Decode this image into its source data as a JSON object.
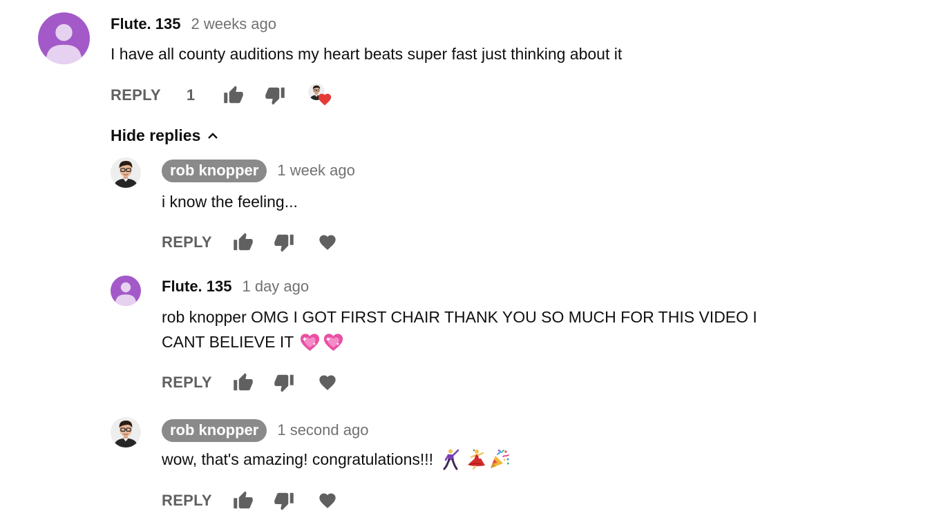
{
  "top_comment": {
    "author": "Flute. 135",
    "time": "2 weeks ago",
    "text": "I have all county auditions my heart beats super fast just thinking about it",
    "reply_label": "REPLY",
    "like_count": "1",
    "avatar_color": "#a35ac8",
    "hearted_by_creator": true
  },
  "replies_toggle": {
    "label": "Hide replies",
    "icon": "chevron-up-icon"
  },
  "replies": [
    {
      "author": "rob knopper",
      "is_creator": true,
      "time": "1 week ago",
      "text": "i know the feeling...",
      "reply_label": "REPLY"
    },
    {
      "author": "Flute. 135",
      "is_creator": false,
      "time": "1 day ago",
      "text_line1": "rob knopper OMG I GOT FIRST CHAIR THANK YOU SO MUCH FOR THIS VIDEO I",
      "text_line2": "CANT BELIEVE IT",
      "emojis": [
        "sparkling-heart-emoji",
        "sparkling-heart-emoji"
      ],
      "reply_label": "REPLY"
    },
    {
      "author": "rob knopper",
      "is_creator": true,
      "time": "1 second ago",
      "text": "wow, that's amazing! congratulations!!!",
      "emojis": [
        "man-dancing-emoji",
        "woman-dancing-emoji",
        "party-popper-emoji"
      ],
      "reply_label": "REPLY"
    }
  ],
  "colors": {
    "creator_chip": "#8a8a8a",
    "secondary_text": "#717171",
    "action_gray": "#606060",
    "heart_red": "#e53935"
  }
}
